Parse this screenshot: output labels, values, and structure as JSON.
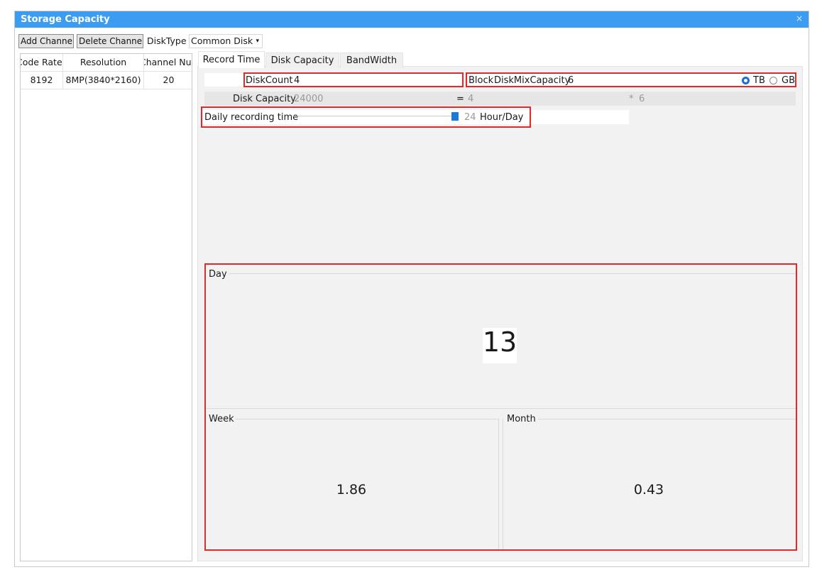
{
  "window": {
    "title": "Storage Capacity",
    "close_glyph": "×"
  },
  "toolbar": {
    "add_channel": "Add Channel",
    "delete_channel": "Delete Channel",
    "disk_type_label": "DiskType",
    "disk_type_value": "Common Disk",
    "dropdown_arrow": "▾"
  },
  "channel_table": {
    "columns": [
      "Code Rate",
      "Resolution",
      "Channel Num"
    ],
    "rows": [
      [
        "8192",
        "8MP(3840*2160)",
        "20"
      ]
    ]
  },
  "tabs": [
    "Record Time",
    "Disk Capacity",
    "BandWidth"
  ],
  "active_tab": "Record Time",
  "form": {
    "disk_count_label": "DiskCount",
    "disk_count_value": "4",
    "block_label": "Block",
    "disk_mix_capacity_label": "DiskMixCapacity",
    "disk_mix_capacity_value": "6",
    "unit_tb": "TB",
    "unit_gb": "GB",
    "selected_unit": "TB",
    "disk_capacity_label": "Disk Capacity",
    "disk_capacity_value": "24000",
    "equals": "=",
    "equals_value": "4",
    "times": "*",
    "times_value": "6",
    "daily_recording_label": "Daily recording time",
    "daily_recording_value": "24",
    "daily_recording_unit": "Hour/Day",
    "daily_recording_level": 1.0
  },
  "results": {
    "day_label": "Day",
    "day_value": "13",
    "week_label": "Week",
    "week_value": "1.86",
    "month_label": "Month",
    "month_value": "0.43"
  },
  "colors": {
    "titlebar": "#3c9df0",
    "highlight": "#e0292b",
    "slider": "#1c7ad6"
  }
}
